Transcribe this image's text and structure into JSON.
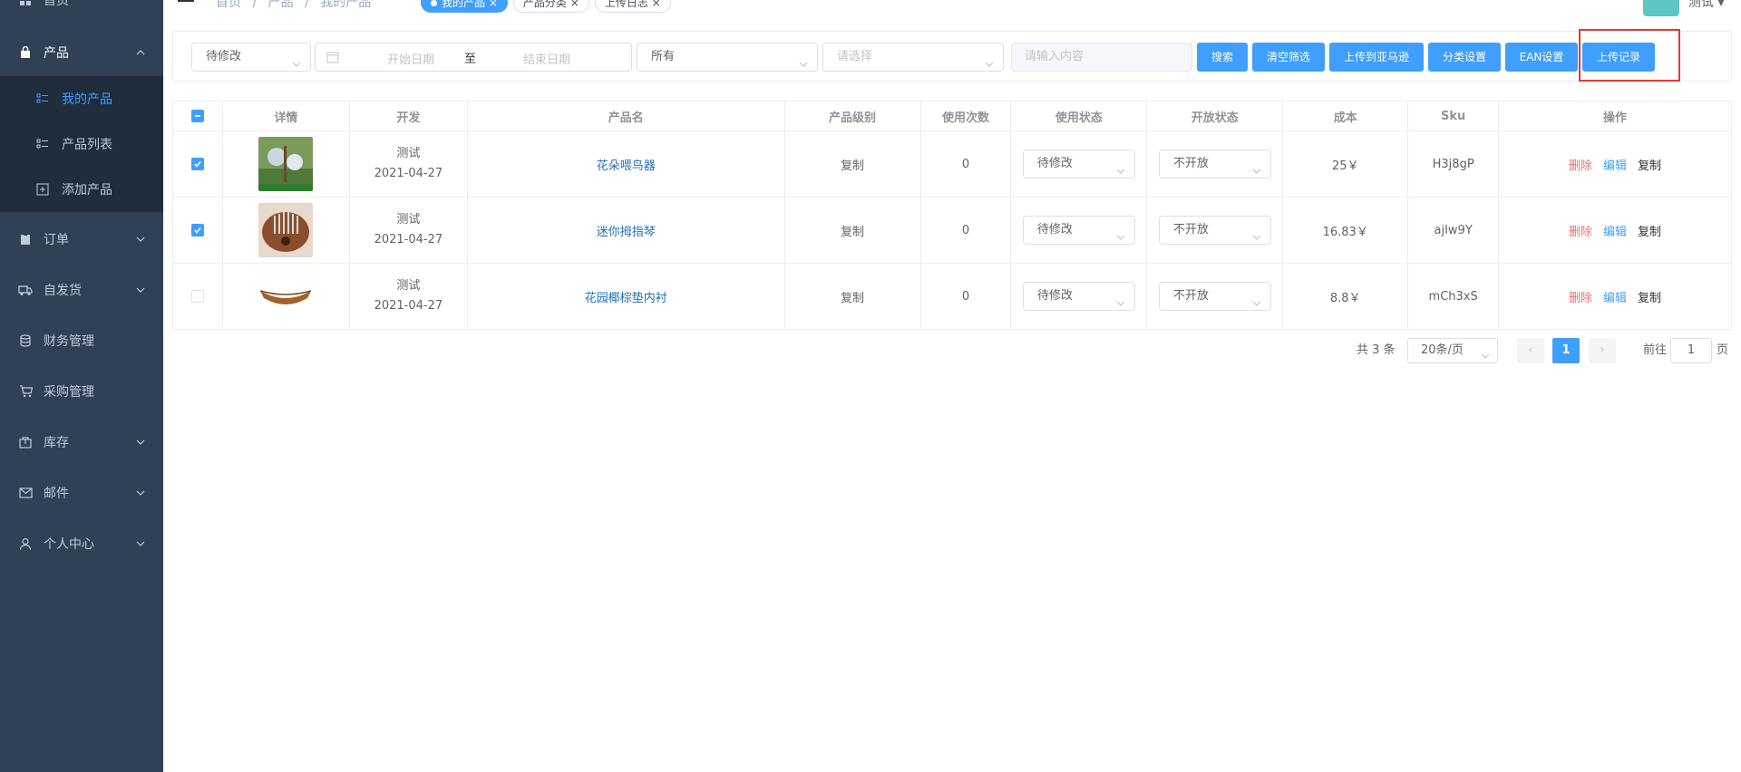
{
  "sidebar": {
    "items": [
      {
        "label": "首页",
        "icon": "dashboard-icon"
      },
      {
        "label": "产品",
        "icon": "bag-icon"
      },
      {
        "label": "订单",
        "icon": "clipboard-icon"
      },
      {
        "label": "自发货",
        "icon": "truck-icon"
      },
      {
        "label": "财务管理",
        "icon": "database-icon"
      },
      {
        "label": "采购管理",
        "icon": "cart-icon"
      },
      {
        "label": "库存",
        "icon": "box-icon"
      },
      {
        "label": "邮件",
        "icon": "mail-icon"
      },
      {
        "label": "个人中心",
        "icon": "user-icon"
      }
    ],
    "submenu": [
      {
        "label": "我的产品"
      },
      {
        "label": "产品列表"
      },
      {
        "label": "添加产品"
      }
    ]
  },
  "topbar": {
    "breadcrumb": [
      "首页",
      "/",
      "产品",
      "/",
      "我的产品"
    ],
    "tags": [
      "我的产品",
      "产品分类",
      "上传日志"
    ],
    "user": "测试"
  },
  "filters": {
    "status_value": "待修改",
    "date_start_placeholder": "开始日期",
    "date_sep": "至",
    "date_end_placeholder": "结束日期",
    "scope_value": "所有",
    "category_placeholder": "请选择",
    "keyword_placeholder": "请输入内容",
    "buttons": {
      "search": "搜索",
      "clear": "清空筛选",
      "upload_amazon": "上传到亚马逊",
      "category_settings": "分类设置",
      "ean_settings": "EAN设置",
      "upload_log": "上传记录"
    }
  },
  "table": {
    "headers": [
      "详情",
      "开发",
      "产品名",
      "产品级别",
      "使用次数",
      "使用状态",
      "开放状态",
      "成本",
      "Sku",
      "操作"
    ],
    "rows": [
      {
        "checked": true,
        "developer": "测试",
        "date": "2021-04-27",
        "name": "花朵喂鸟器",
        "level": "复制",
        "uses": "0",
        "use_status": "待修改",
        "open_status": "不开放",
        "cost": "25￥",
        "sku": "H3j8gP",
        "thumb": "bird-feeder-thumb"
      },
      {
        "checked": true,
        "developer": "测试",
        "date": "2021-04-27",
        "name": "迷你拇指琴",
        "level": "复制",
        "uses": "0",
        "use_status": "待修改",
        "open_status": "不开放",
        "cost": "16.83￥",
        "sku": "ajIw9Y",
        "thumb": "kalimba-thumb"
      },
      {
        "checked": false,
        "developer": "测试",
        "date": "2021-04-27",
        "name": "花园椰棕垫内衬",
        "level": "复制",
        "uses": "0",
        "use_status": "待修改",
        "open_status": "不开放",
        "cost": "8.8￥",
        "sku": "mCh3xS",
        "thumb": "coco-liner-thumb"
      }
    ],
    "actions": {
      "delete": "删除",
      "edit": "编辑",
      "copy": "复制"
    }
  },
  "pagination": {
    "total": "共 3 条",
    "page_size": "20条/页",
    "current": "1",
    "goto_prefix": "前往",
    "goto_value": "1",
    "goto_suffix": "页"
  },
  "colors": {
    "sidebar_bg": "#304156",
    "submenu_bg": "#1f2d3d",
    "primary": "#409eff",
    "danger": "#f56c6c",
    "highlight_box": "#e53935"
  }
}
